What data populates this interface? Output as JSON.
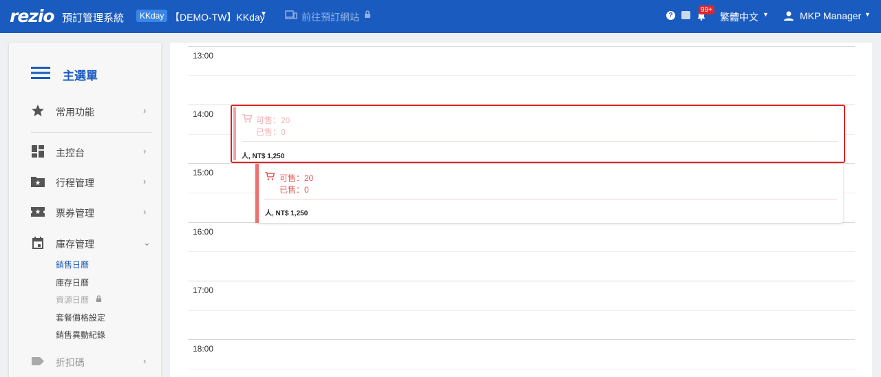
{
  "header": {
    "logo": "rezio",
    "app_title": "預訂管理系統",
    "channel_badge": "KKday",
    "store_name": "【DEMO-TW】KKday",
    "goto_booking_site": "前往預訂網站",
    "notification_count": "99+",
    "language": "繁體中文",
    "user_name": "MKP Manager"
  },
  "sidebar": {
    "title": "主選單",
    "items": [
      {
        "label": "常用功能",
        "icon": "star-icon"
      },
      {
        "label": "主控台",
        "icon": "dashboard-icon"
      },
      {
        "label": "行程管理",
        "icon": "folder-star-icon"
      },
      {
        "label": "票券管理",
        "icon": "ticket-icon"
      },
      {
        "label": "庫存管理",
        "icon": "calendar-icon"
      },
      {
        "label": "折扣碼",
        "icon": "tag-icon"
      }
    ],
    "sub_items": [
      {
        "label": "銷售日曆"
      },
      {
        "label": "庫存日曆"
      },
      {
        "label": "資源日曆"
      },
      {
        "label": "套餐價格設定"
      },
      {
        "label": "銷售異動紀錄"
      }
    ]
  },
  "calendar": {
    "hours": [
      "13:00",
      "14:00",
      "15:00",
      "16:00",
      "17:00",
      "18:00"
    ],
    "events": [
      {
        "available": "可售：20",
        "sold": "已售：0",
        "price": "人, NT$ 1,250"
      },
      {
        "available": "可售：20",
        "sold": "已售：0",
        "price": "人, NT$ 1,250"
      }
    ]
  },
  "colors": {
    "header_bg": "#1a5bbf",
    "accent": "#1a5bbf",
    "event_bar": "#ef7070",
    "selection_border": "#e02020",
    "notification_badge": "#e0262b"
  }
}
